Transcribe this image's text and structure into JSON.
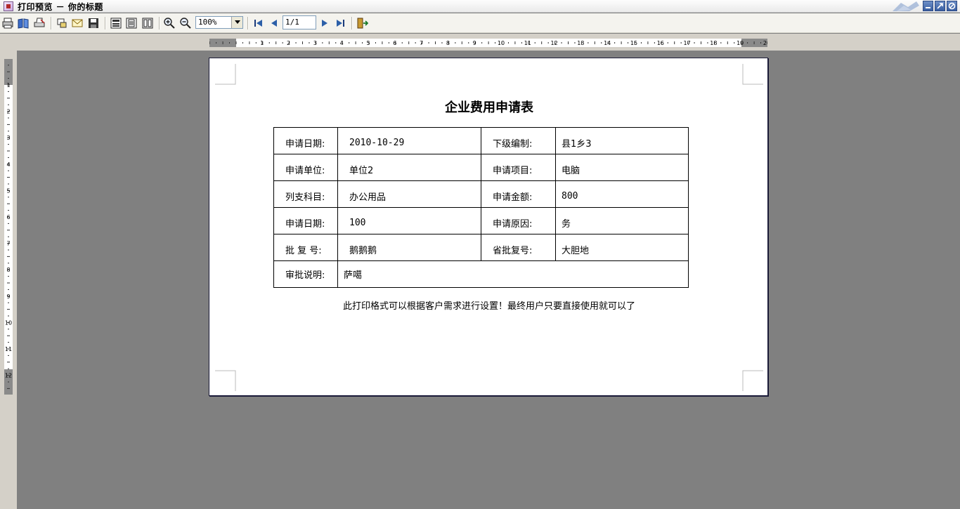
{
  "window": {
    "title": "打印预览 － 你的标题"
  },
  "toolbar": {
    "buttons": [
      {
        "name": "print-icon"
      },
      {
        "name": "book-icon"
      },
      {
        "name": "printer-setup-icon"
      },
      {
        "name": "export-icon"
      },
      {
        "name": "mail-icon"
      },
      {
        "name": "save-icon"
      },
      {
        "name": "layout-icon"
      },
      {
        "name": "single-page-icon"
      },
      {
        "name": "multi-page-icon"
      },
      {
        "name": "zoom-in-icon"
      },
      {
        "name": "zoom-out-icon"
      },
      {
        "name": "first-page-icon"
      },
      {
        "name": "prev-page-icon"
      },
      {
        "name": "next-page-icon"
      },
      {
        "name": "last-page-icon"
      },
      {
        "name": "exit-icon"
      }
    ],
    "zoom": "100%",
    "page": "1/1"
  },
  "ruler": {
    "h_marks": [
      "1",
      "2",
      "3",
      "4",
      "5",
      "6",
      "7",
      "8",
      "9",
      "10",
      "11",
      "12",
      "13",
      "14",
      "15",
      "16",
      "17",
      "18",
      "19",
      "20"
    ],
    "v_marks": [
      "1",
      "2",
      "3",
      "4",
      "5",
      "6",
      "7",
      "8",
      "9",
      "10",
      "11",
      "12"
    ]
  },
  "document": {
    "title": "企业费用申请表",
    "rows": [
      {
        "l1": "申请日期:",
        "v1": "2010-10-29",
        "l2": "下级编制:",
        "v2": "县1乡3"
      },
      {
        "l1": "申请单位:",
        "v1": "单位2",
        "l2": "申请项目:",
        "v2": "电脑"
      },
      {
        "l1": "列支科目:",
        "v1": "办公用品",
        "l2": "申请金额:",
        "v2": "800"
      },
      {
        "l1": "申请日期:",
        "v1": "100",
        "l2": "申请原因:",
        "v2": "务"
      },
      {
        "l1": "批 复 号:",
        "v1": "鹅鹅鹅",
        "l2": "省批复号:",
        "v2": "大胆地"
      }
    ],
    "approval_label": "审批说明:",
    "approval_value": "萨噶",
    "footnote": "此打印格式可以根据客户需求进行设置！最终用户只要直接使用就可以了"
  },
  "colors": {
    "preview_bg": "#808080",
    "chrome_bg": "#d4d0c8",
    "page_border": "#1a1a38"
  }
}
